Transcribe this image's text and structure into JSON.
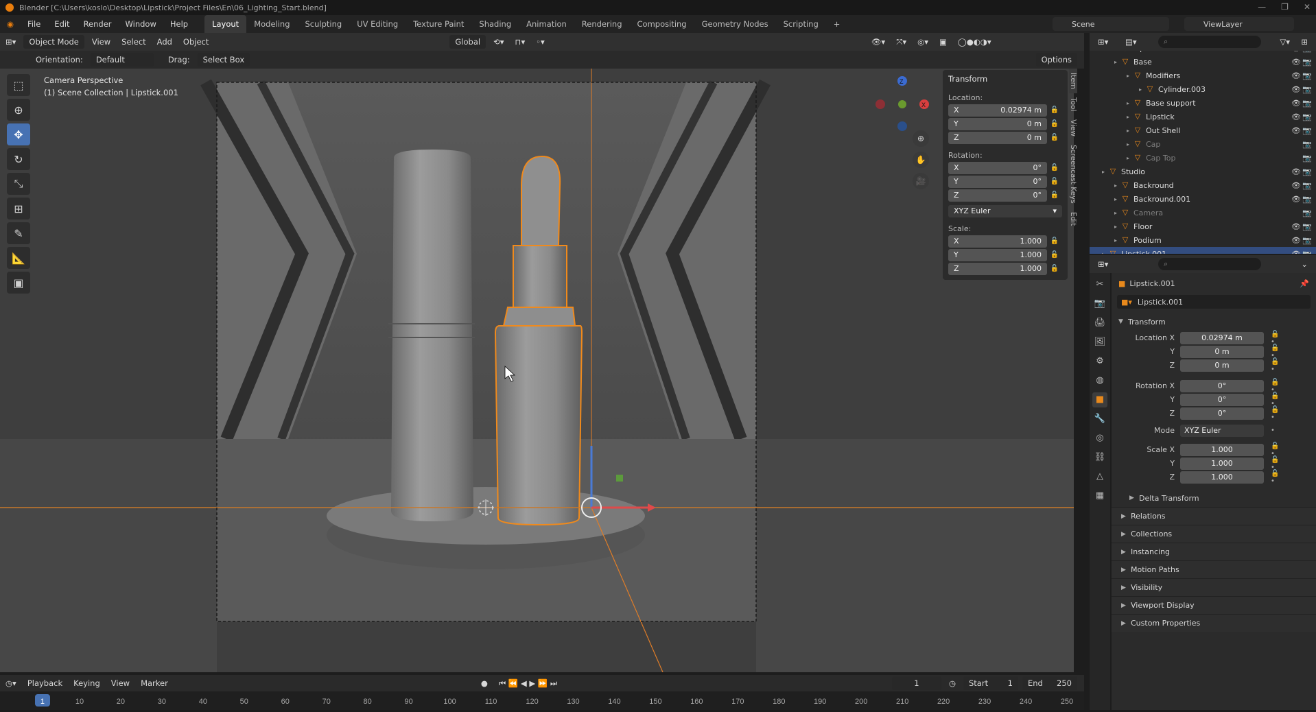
{
  "title_bar": {
    "text": "Blender [C:\\Users\\koslo\\Desktop\\Lipstick\\Project Files\\En\\06_Lighting_Start.blend]"
  },
  "menu": {
    "items": [
      "File",
      "Edit",
      "Render",
      "Window",
      "Help"
    ]
  },
  "workspaces": {
    "tabs": [
      "Layout",
      "Modeling",
      "Sculpting",
      "UV Editing",
      "Texture Paint",
      "Shading",
      "Animation",
      "Rendering",
      "Compositing",
      "Geometry Nodes",
      "Scripting"
    ],
    "add": "+"
  },
  "scene": {
    "name": "Scene",
    "view_layer": "ViewLayer"
  },
  "viewport_header": {
    "mode": "Object Mode",
    "view": "View",
    "select": "Select",
    "add": "Add",
    "object": "Object",
    "transform_orientation": "Global"
  },
  "tool_header": {
    "orientation_label": "Orientation:",
    "orientation_value": "Default",
    "drag_label": "Drag:",
    "drag_value": "Select Box",
    "options": "Options"
  },
  "viewport": {
    "camera_label": "Camera Perspective",
    "collection_label": "(1) Scene Collection | Lipstick.001"
  },
  "gizmo": {
    "z": "Z",
    "x": "X"
  },
  "n_panel": {
    "header": "Transform",
    "location_label": "Location:",
    "location": [
      {
        "axis": "X",
        "value": "0.02974 m"
      },
      {
        "axis": "Y",
        "value": "0 m"
      },
      {
        "axis": "Z",
        "value": "0 m"
      }
    ],
    "rotation_label": "Rotation:",
    "rotation": [
      {
        "axis": "X",
        "value": "0°"
      },
      {
        "axis": "Y",
        "value": "0°"
      },
      {
        "axis": "Z",
        "value": "0°"
      }
    ],
    "rotation_mode": "XYZ Euler",
    "scale_label": "Scale:",
    "scale": [
      {
        "axis": "X",
        "value": "1.000"
      },
      {
        "axis": "Y",
        "value": "1.000"
      },
      {
        "axis": "Z",
        "value": "1.000"
      }
    ],
    "tabs": [
      "Item",
      "Tool",
      "View",
      "Screencast Keys",
      "Edit"
    ]
  },
  "outliner": {
    "rows": [
      {
        "label": "Lipstick",
        "depth": 2,
        "dim": false
      },
      {
        "label": "Base",
        "depth": 2,
        "dim": false
      },
      {
        "label": "Modifiers",
        "depth": 3,
        "dim": false
      },
      {
        "label": "Cylinder.003",
        "depth": 4,
        "dim": false
      },
      {
        "label": "Base support",
        "depth": 3,
        "dim": false
      },
      {
        "label": "Lipstick",
        "depth": 3,
        "dim": false
      },
      {
        "label": "Out Shell",
        "depth": 3,
        "dim": false
      },
      {
        "label": "Cap",
        "depth": 3,
        "dim": true
      },
      {
        "label": "Cap Top",
        "depth": 3,
        "dim": true
      },
      {
        "label": "Studio",
        "depth": 1,
        "dim": false
      },
      {
        "label": "Backround",
        "depth": 2,
        "dim": false
      },
      {
        "label": "Backround.001",
        "depth": 2,
        "dim": false
      },
      {
        "label": "Camera",
        "depth": 2,
        "dim": true
      },
      {
        "label": "Floor",
        "depth": 2,
        "dim": false
      },
      {
        "label": "Podium",
        "depth": 2,
        "dim": false
      },
      {
        "label": "Lipstick.001",
        "depth": 1,
        "dim": false
      }
    ]
  },
  "properties": {
    "object_name": "Lipstick.001",
    "data_name": "Lipstick.001",
    "transform_header": "Transform",
    "location": [
      {
        "label": "Location X",
        "value": "0.02974 m"
      },
      {
        "label": "Y",
        "value": "0 m"
      },
      {
        "label": "Z",
        "value": "0 m"
      }
    ],
    "rotation": [
      {
        "label": "Rotation X",
        "value": "0°"
      },
      {
        "label": "Y",
        "value": "0°"
      },
      {
        "label": "Z",
        "value": "0°"
      }
    ],
    "mode_label": "Mode",
    "mode_value": "XYZ Euler",
    "scale": [
      {
        "label": "Scale X",
        "value": "1.000"
      },
      {
        "label": "Y",
        "value": "1.000"
      },
      {
        "label": "Z",
        "value": "1.000"
      }
    ],
    "delta": "Delta Transform",
    "sections": [
      "Relations",
      "Collections",
      "Instancing",
      "Motion Paths",
      "Visibility",
      "Viewport Display",
      "Custom Properties"
    ]
  },
  "timeline": {
    "playback": "Playback",
    "keying": "Keying",
    "view": "View",
    "marker": "Marker",
    "current_frame": "1",
    "start_label": "Start",
    "start": "1",
    "end_label": "End",
    "end": "250",
    "ticks": [
      "1",
      "10",
      "20",
      "30",
      "40",
      "50",
      "60",
      "70",
      "80",
      "90",
      "100",
      "110",
      "120",
      "130",
      "140",
      "150",
      "160",
      "170",
      "180",
      "190",
      "200",
      "210",
      "220",
      "230",
      "240",
      "250"
    ]
  }
}
